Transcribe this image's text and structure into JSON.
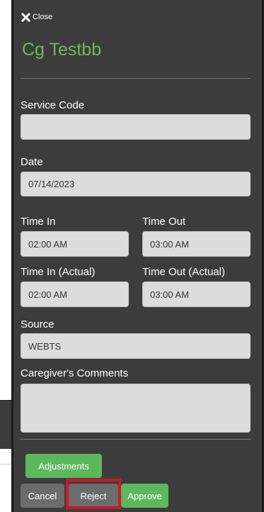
{
  "close": {
    "label": "Close",
    "icon": "close-icon"
  },
  "title": "Cg Testbb",
  "service_code": {
    "label": "Service Code",
    "value": ""
  },
  "date": {
    "label": "Date",
    "value": "07/14/2023"
  },
  "time_in": {
    "label": "Time In",
    "value": "02:00 AM"
  },
  "time_out": {
    "label": "Time Out",
    "value": "03:00 AM"
  },
  "time_in_actual": {
    "label": "Time In (Actual)",
    "value": "02:00 AM"
  },
  "time_out_actual": {
    "label": "Time Out (Actual)",
    "value": "03:00 AM"
  },
  "source": {
    "label": "Source",
    "value": "WEBTS"
  },
  "comments": {
    "label": "Caregiver's Comments",
    "value": ""
  },
  "buttons": {
    "adjustments": "Adjustments",
    "cancel": "Cancel",
    "reject": "Reject",
    "approve": "Approve"
  },
  "colors": {
    "panel_bg": "#3c3c3c",
    "title_green": "#6cba55",
    "button_green": "#5cb85c",
    "button_gray": "#6c6c6c",
    "highlight_red": "#d0152a"
  }
}
